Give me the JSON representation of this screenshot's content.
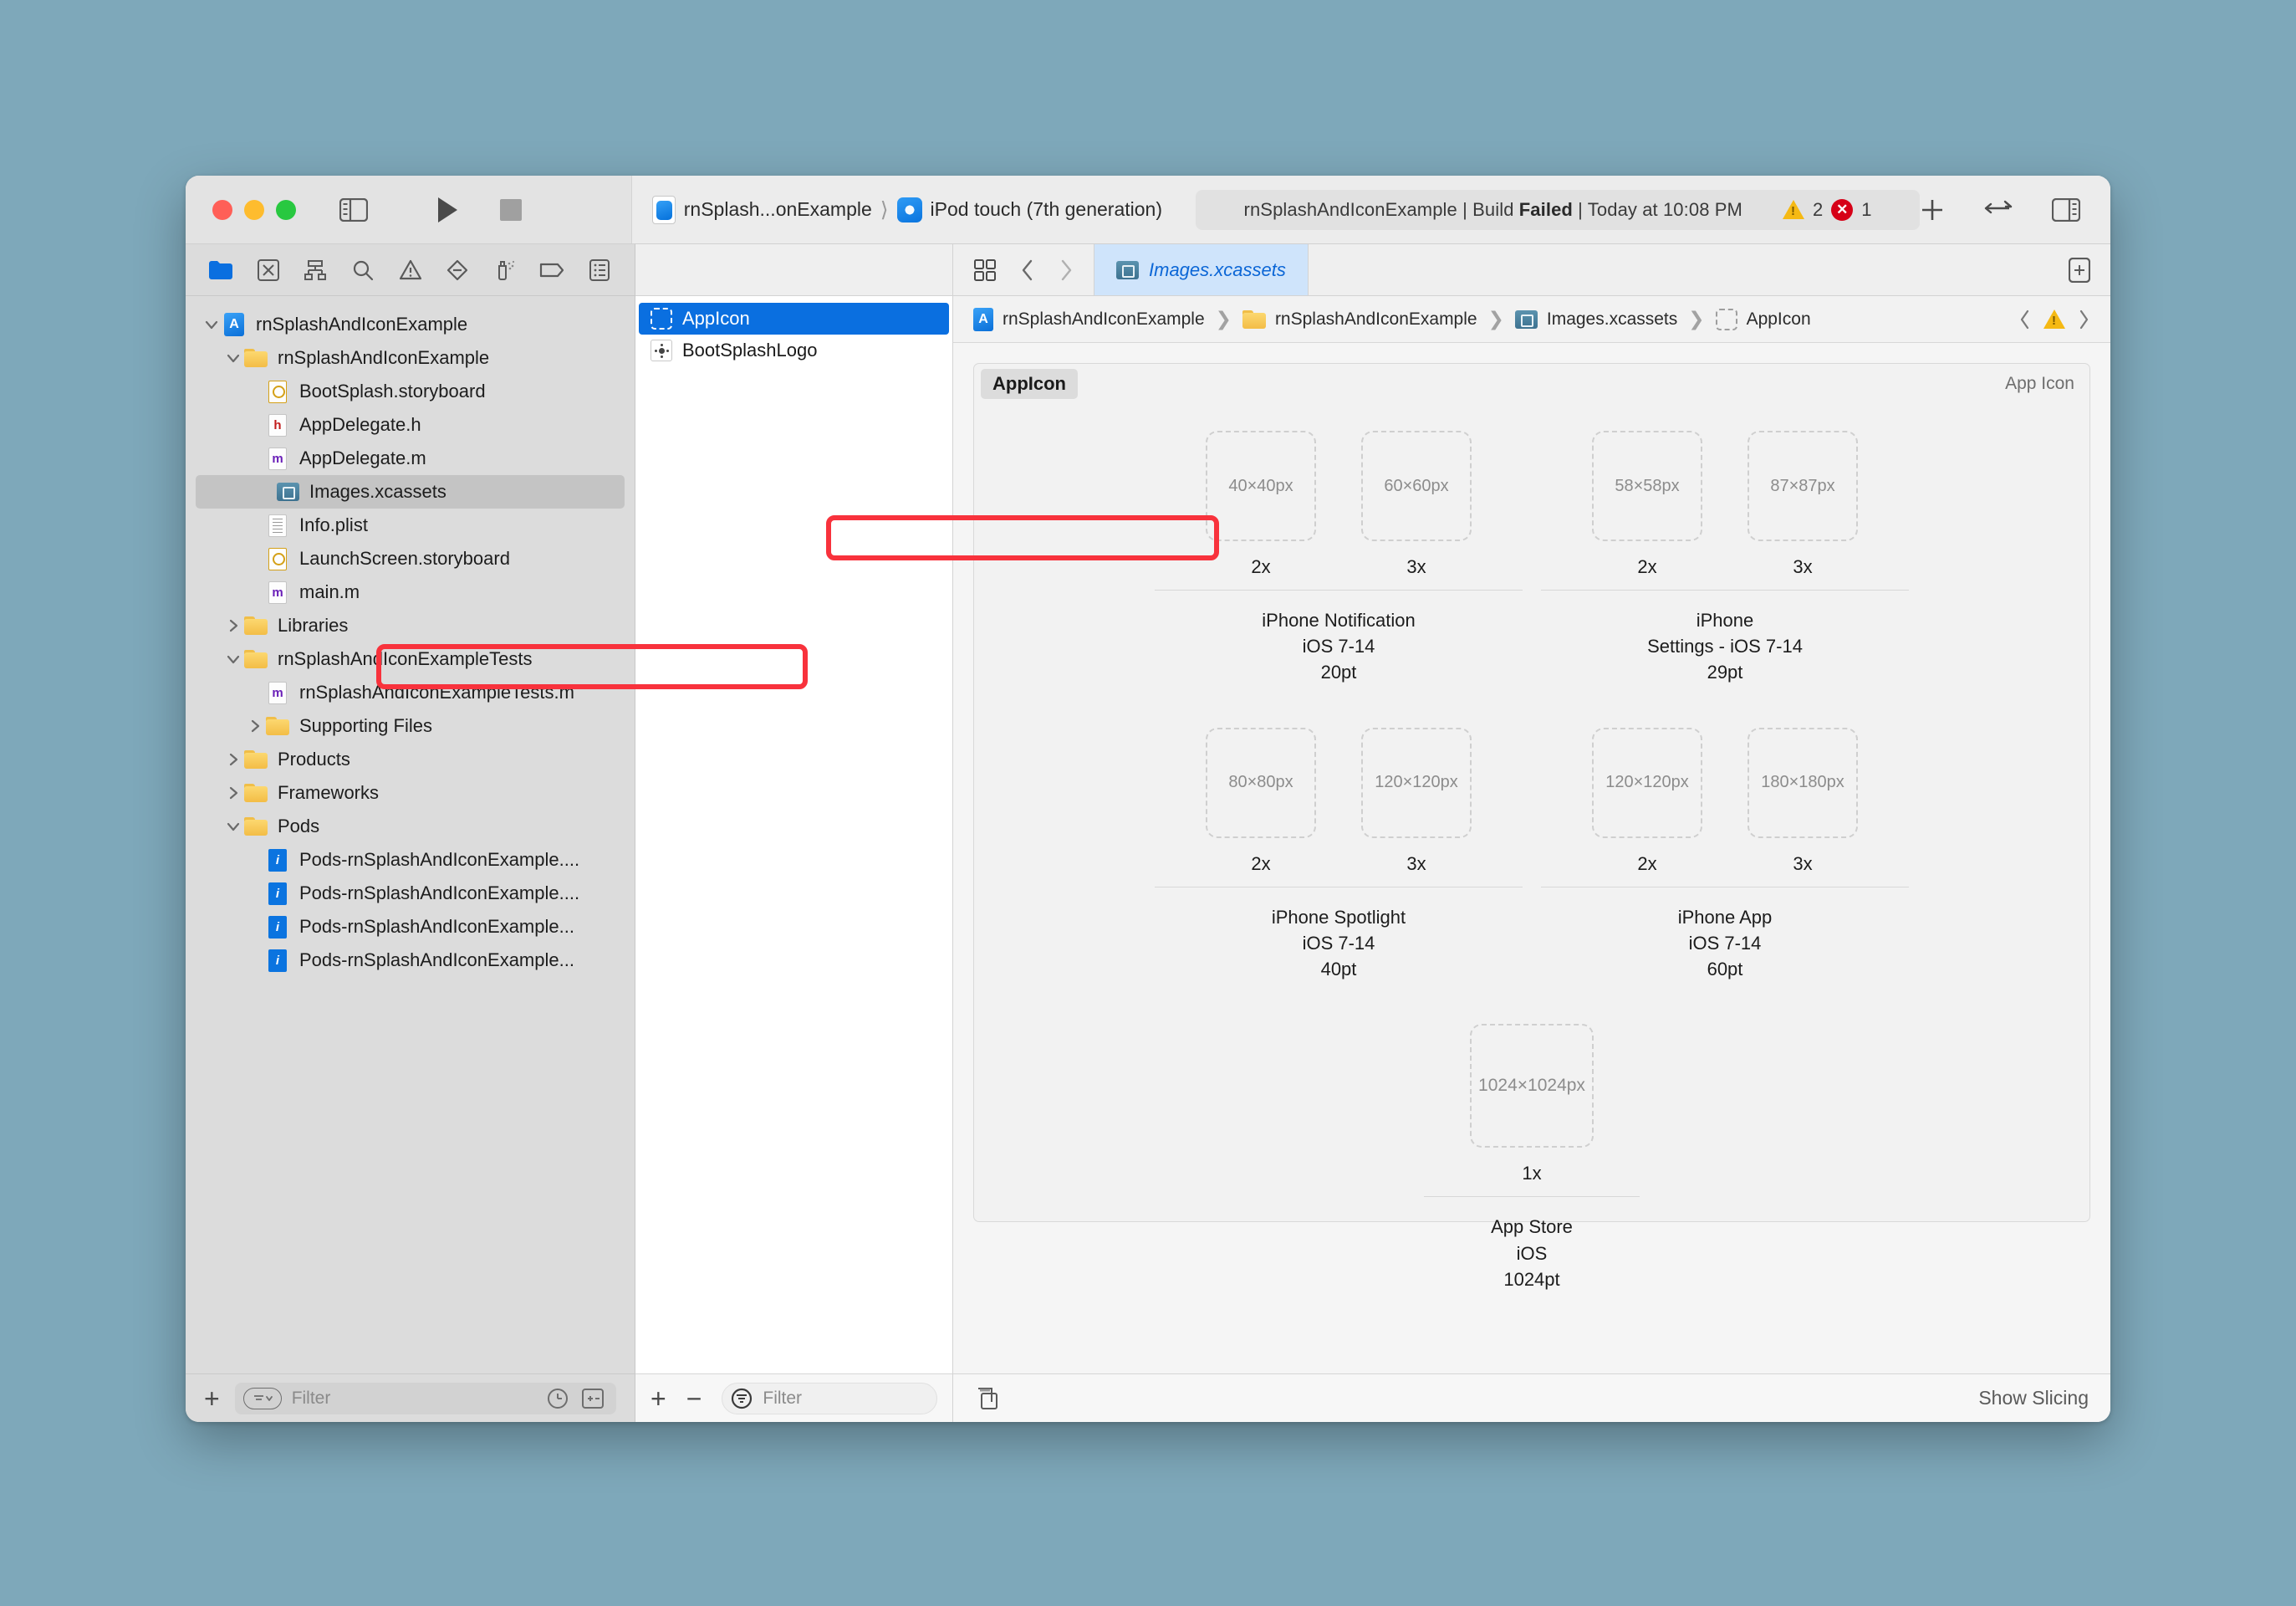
{
  "window": {
    "traffic_lights": [
      "close",
      "minimize",
      "zoom"
    ]
  },
  "toolbar": {
    "scheme_name": "rnSplash...onExample",
    "destination": "iPod touch (7th generation)",
    "status_prefix": "rnSplashAndIconExample | Build ",
    "status_bold": "Failed",
    "status_suffix": " | Today at 10:08 PM",
    "warning_count": "2",
    "error_count": "1",
    "add_label": "+",
    "icons": {
      "sidebar_toggle": "sidebar-toggle-icon",
      "run": "run-icon",
      "stop": "stop-icon",
      "add": "add-icon",
      "code_review": "code-review-icon",
      "inspector_toggle": "inspector-toggle-icon"
    }
  },
  "navigator": {
    "tools": [
      {
        "name": "project-navigator-icon",
        "active": true
      },
      {
        "name": "source-control-navigator-icon",
        "active": false
      },
      {
        "name": "symbol-navigator-icon",
        "active": false
      },
      {
        "name": "find-navigator-icon",
        "active": false
      },
      {
        "name": "issue-navigator-icon",
        "active": false
      },
      {
        "name": "test-navigator-icon",
        "active": false
      },
      {
        "name": "debug-navigator-icon",
        "active": false
      },
      {
        "name": "breakpoint-navigator-icon",
        "active": false
      },
      {
        "name": "report-navigator-icon",
        "active": false
      }
    ],
    "tree": [
      {
        "label": "rnSplashAndIconExample",
        "depth": 0,
        "icon": "project",
        "disclosure": "open"
      },
      {
        "label": "rnSplashAndIconExample",
        "depth": 1,
        "icon": "folder",
        "disclosure": "open"
      },
      {
        "label": "BootSplash.storyboard",
        "depth": 2,
        "icon": "storyboard",
        "disclosure": "none"
      },
      {
        "label": "AppDelegate.h",
        "depth": 2,
        "icon": "h",
        "disclosure": "none"
      },
      {
        "label": "AppDelegate.m",
        "depth": 2,
        "icon": "m",
        "disclosure": "none"
      },
      {
        "label": "Images.xcassets",
        "depth": 2,
        "icon": "xcassets",
        "disclosure": "none",
        "selected": true
      },
      {
        "label": "Info.plist",
        "depth": 2,
        "icon": "plist",
        "disclosure": "none"
      },
      {
        "label": "LaunchScreen.storyboard",
        "depth": 2,
        "icon": "storyboard",
        "disclosure": "none"
      },
      {
        "label": "main.m",
        "depth": 2,
        "icon": "m",
        "disclosure": "none"
      },
      {
        "label": "Libraries",
        "depth": 1,
        "icon": "folder",
        "disclosure": "closed"
      },
      {
        "label": "rnSplashAndIconExampleTests",
        "depth": 1,
        "icon": "folder",
        "disclosure": "open"
      },
      {
        "label": "rnSplashAndIconExampleTests.m",
        "depth": 2,
        "icon": "m",
        "disclosure": "none"
      },
      {
        "label": "Supporting Files",
        "depth": 2,
        "icon": "folder",
        "disclosure": "closed"
      },
      {
        "label": "Products",
        "depth": 1,
        "icon": "folder",
        "disclosure": "closed"
      },
      {
        "label": "Frameworks",
        "depth": 1,
        "icon": "folder",
        "disclosure": "closed"
      },
      {
        "label": "Pods",
        "depth": 1,
        "icon": "folder",
        "disclosure": "open"
      },
      {
        "label": "Pods-rnSplashAndIconExample....",
        "depth": 2,
        "icon": "config",
        "disclosure": "none"
      },
      {
        "label": "Pods-rnSplashAndIconExample....",
        "depth": 2,
        "icon": "config",
        "disclosure": "none"
      },
      {
        "label": "Pods-rnSplashAndIconExample...",
        "depth": 2,
        "icon": "config",
        "disclosure": "none"
      },
      {
        "label": "Pods-rnSplashAndIconExample...",
        "depth": 2,
        "icon": "config",
        "disclosure": "none"
      }
    ],
    "filter_placeholder": "Filter",
    "add_button": "+"
  },
  "asset_list": {
    "items": [
      {
        "label": "AppIcon",
        "icon": "dashed-slot",
        "selected": true
      },
      {
        "label": "BootSplashLogo",
        "icon": "react-logo",
        "selected": false
      }
    ],
    "add_button": "+",
    "remove_button": "−",
    "filter_placeholder": "Filter"
  },
  "editor": {
    "tab_label": "Images.xcassets",
    "breadcrumb": [
      {
        "label": "rnSplashAndIconExample",
        "icon": "project"
      },
      {
        "label": "rnSplashAndIconExample",
        "icon": "folder"
      },
      {
        "label": "Images.xcassets",
        "icon": "xcassets"
      },
      {
        "label": "AppIcon",
        "icon": "dashed-slot"
      }
    ],
    "panel_title": "AppIcon",
    "panel_kind": "App Icon",
    "show_slicing_label": "Show Slicing",
    "icon_groups": [
      {
        "caption_lines": [
          "iPhone Notification",
          "iOS 7-14",
          "20pt"
        ],
        "slots": [
          {
            "size": "40×40px",
            "scale": "2x"
          },
          {
            "size": "60×60px",
            "scale": "3x"
          }
        ]
      },
      {
        "caption_lines": [
          "iPhone",
          "Settings - iOS 7-14",
          "29pt"
        ],
        "slots": [
          {
            "size": "58×58px",
            "scale": "2x"
          },
          {
            "size": "87×87px",
            "scale": "3x"
          }
        ]
      },
      {
        "caption_lines": [
          "iPhone Spotlight",
          "iOS 7-14",
          "40pt"
        ],
        "slots": [
          {
            "size": "80×80px",
            "scale": "2x"
          },
          {
            "size": "120×120px",
            "scale": "3x"
          }
        ]
      },
      {
        "caption_lines": [
          "iPhone App",
          "iOS 7-14",
          "60pt"
        ],
        "slots": [
          {
            "size": "120×120px",
            "scale": "2x"
          },
          {
            "size": "180×180px",
            "scale": "3x"
          }
        ]
      },
      {
        "caption_lines": [
          "App Store",
          "iOS",
          "1024pt"
        ],
        "slots": [
          {
            "size": "1024×1024px",
            "scale": "1x"
          }
        ]
      }
    ]
  },
  "annotations": {
    "color": "#F8323C",
    "targets": [
      "Images.xcassets navigator row",
      "AppIcon asset row"
    ]
  }
}
